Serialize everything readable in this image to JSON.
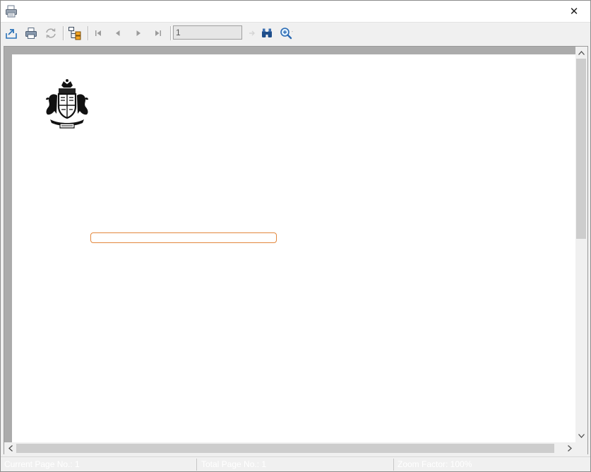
{
  "titlebar": {
    "app_icon": "printer-icon",
    "close_label": "✕"
  },
  "toolbar": {
    "export_icon": "export-icon",
    "print_icon": "print-icon",
    "refresh_icon": "refresh-icon",
    "tree_icon": "group-tree-icon",
    "first_icon": "first-page-icon",
    "prev_icon": "previous-page-icon",
    "next_icon": "next-page-icon",
    "last_icon": "last-page-icon",
    "page_value": "1",
    "goto_icon": "go-to-page-icon",
    "find_icon": "binoculars-icon",
    "zoom_icon": "zoom-icon"
  },
  "document": {
    "emblem": "royal-coat-of-arms"
  },
  "status": {
    "current_page": "Current Page No.: 1",
    "total_pages": "Total Page No.: 1",
    "zoom_factor": "Zoom Factor: 100%"
  }
}
